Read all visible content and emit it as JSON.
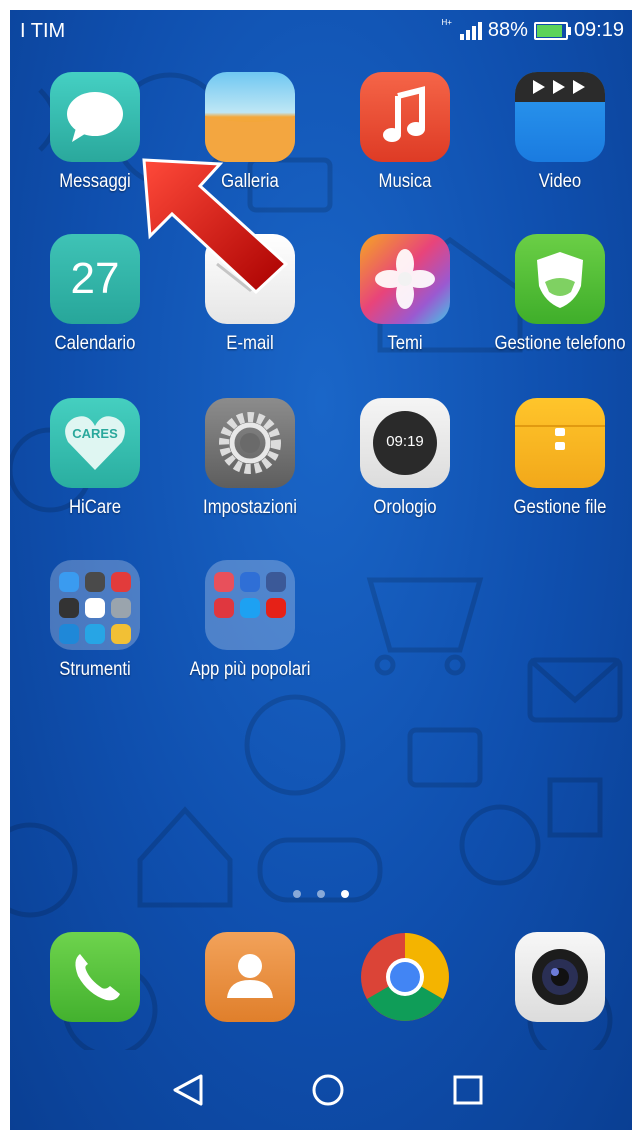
{
  "status_bar": {
    "carrier": "I TIM",
    "network": "H+",
    "battery": "88%",
    "time": "09:19"
  },
  "apps": [
    {
      "name": "Messaggi"
    },
    {
      "name": "Galleria"
    },
    {
      "name": "Musica"
    },
    {
      "name": "Video"
    },
    {
      "name": "27",
      "label": "Calendario"
    },
    {
      "name": "E-mail"
    },
    {
      "name": "Temi"
    },
    {
      "name": "Gestione telefono"
    },
    {
      "badge": "CARES",
      "label": "HiCare"
    },
    {
      "name": "Impostazioni"
    },
    {
      "time": "09:19",
      "label": "Orologio"
    },
    {
      "name": "Gestione file"
    }
  ],
  "folders": [
    {
      "name": "Strumenti"
    },
    {
      "name": "App più popolari"
    }
  ],
  "dock": [
    {
      "icon": "phone-icon"
    },
    {
      "icon": "contacts-icon"
    },
    {
      "icon": "chrome-icon"
    },
    {
      "icon": "camera-icon"
    }
  ],
  "page_indicator": {
    "pages": 3,
    "current": 3
  },
  "nav": {
    "back": "back-icon",
    "home": "home-icon",
    "recents": "recents-icon"
  },
  "colors": {
    "background": "#1258bd",
    "arrow": "#c40000",
    "messaggi": "#3cc1b5",
    "musica": "#ec4a32"
  }
}
